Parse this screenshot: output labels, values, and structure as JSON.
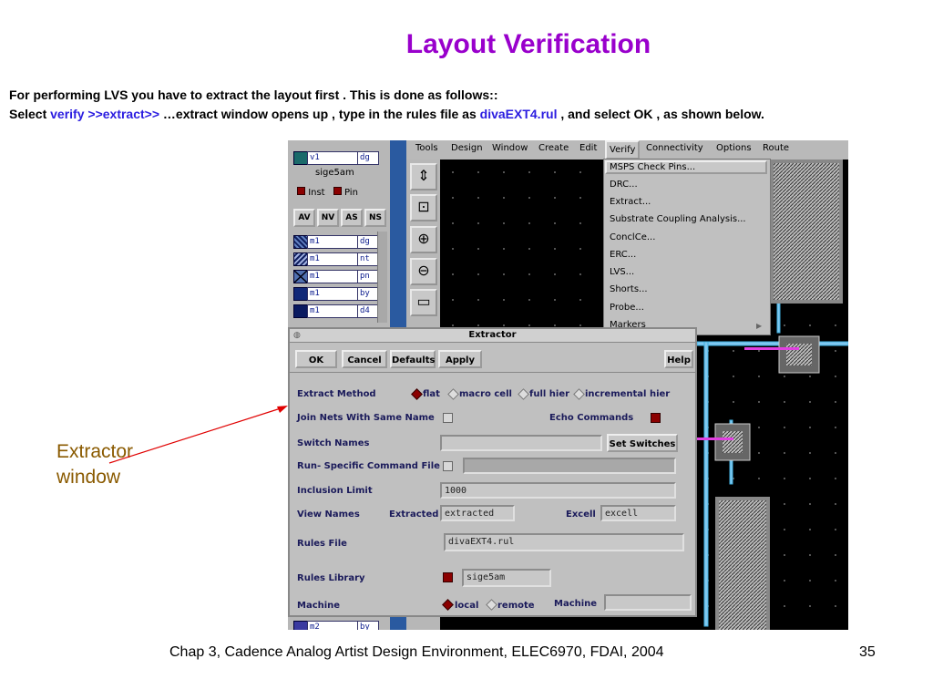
{
  "slide": {
    "title": "Layout Verification",
    "intro_line1": "For performing LVS you have to extract the layout first . This is done as follows::",
    "intro_select": "Select",
    "intro_cmd": "verify >>extract>>",
    "intro_mid": "…extract window opens up , type in the rules file as",
    "intro_rules": "divaEXT4.rul",
    "intro_end": ", and select OK , as shown below.",
    "callout_line1": "Extractor",
    "callout_line2": "window",
    "footer": "Chap 3, Cadence Analog Artist Design Environment, ELEC6970, FDAI, 2004",
    "page_number": "35"
  },
  "lsw": {
    "top_layer": "v1",
    "top_purpose": "dg",
    "lib": "sige5am",
    "inst_label": "Inst",
    "pin_label": "Pin",
    "buttons": [
      "AV",
      "NV",
      "AS",
      "NS"
    ],
    "layers": [
      {
        "name": "m1",
        "purpose": "dg"
      },
      {
        "name": "m1",
        "purpose": "nt"
      },
      {
        "name": "m1",
        "purpose": "pn"
      },
      {
        "name": "m1",
        "purpose": "by"
      },
      {
        "name": "m1",
        "purpose": "d4"
      }
    ],
    "bottom_layer": "m2",
    "bottom_purpose": "by"
  },
  "menubar": [
    "Tools",
    "Design",
    "Window",
    "Create",
    "Edit",
    "Verify",
    "Connectivity",
    "Options",
    "Route"
  ],
  "verify_menu": [
    "MSPS Check Pins...",
    "DRC...",
    "Extract...",
    "Substrate Coupling Analysis...",
    "ConclCe...",
    "ERC...",
    "LVS...",
    "Shorts...",
    "Probe...",
    "Markers"
  ],
  "dialog": {
    "title": "Extractor",
    "buttons": {
      "ok": "OK",
      "cancel": "Cancel",
      "defaults": "Defaults",
      "apply": "Apply",
      "help": "Help"
    },
    "extract_method_label": "Extract Method",
    "methods": [
      "flat",
      "macro cell",
      "full hier",
      "incremental hier"
    ],
    "join_nets_label": "Join Nets With Same Name",
    "echo_label": "Echo Commands",
    "switch_names_label": "Switch Names",
    "set_switches": "Set Switches",
    "run_specific_label": "Run- Specific Command File",
    "inclusion_label": "Inclusion Limit",
    "inclusion_value": "1000",
    "view_names_label": "View Names",
    "extracted_label": "Extracted",
    "extracted_value": "extracted",
    "excell_label": "Excell",
    "excell_value": "excell",
    "rules_file_label": "Rules File",
    "rules_file_value": "divaEXT4.rul",
    "rules_library_label": "Rules Library",
    "rules_library_value": "sige5am",
    "machine_label": "Machine",
    "machine_options": [
      "local",
      "remote"
    ],
    "machine_label2": "Machine"
  },
  "colors": {
    "title": "#9900cc",
    "highlight": "#2a1ce0",
    "callout": "#8a5a00",
    "menu_sel": "#8b0000"
  }
}
